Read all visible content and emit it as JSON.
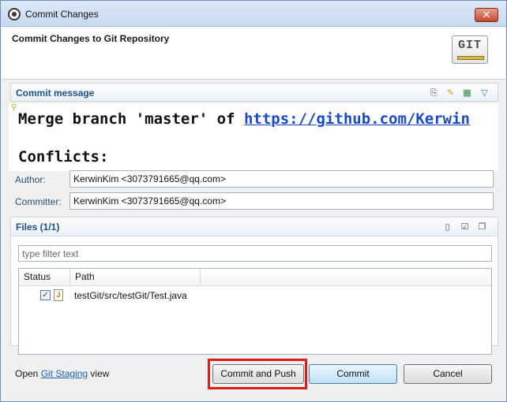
{
  "window": {
    "title": "Commit Changes"
  },
  "header": {
    "title": "Commit Changes to Git Repository",
    "logo_text": "GIT"
  },
  "commit_message": {
    "section_title": "Commit message",
    "line1_text": "Merge branch 'master' of ",
    "line1_link": "https://github.com/Kerwin",
    "line2": "Conflicts:"
  },
  "author": {
    "label": "Author:",
    "value": "KerwinKim <3073791665@qq.com>"
  },
  "committer": {
    "label": "Committer:",
    "value": "KerwinKim <3073791665@qq.com>"
  },
  "files": {
    "section_title": "Files (1/1)",
    "filter_placeholder": "type filter text",
    "columns": [
      "Status",
      "Path"
    ],
    "rows": [
      {
        "checked": true,
        "path": "testGit/src/testGit/Test.java"
      }
    ]
  },
  "footer": {
    "open_text": "Open",
    "link_text": "Git Staging",
    "view_text": "view"
  },
  "buttons": {
    "commit_and_push": "Commit and Push",
    "commit": "Commit",
    "cancel": "Cancel"
  },
  "colors": {
    "highlight": "#e01b1b",
    "section_title": "#1d4f8a",
    "link": "#1a5fb4"
  }
}
